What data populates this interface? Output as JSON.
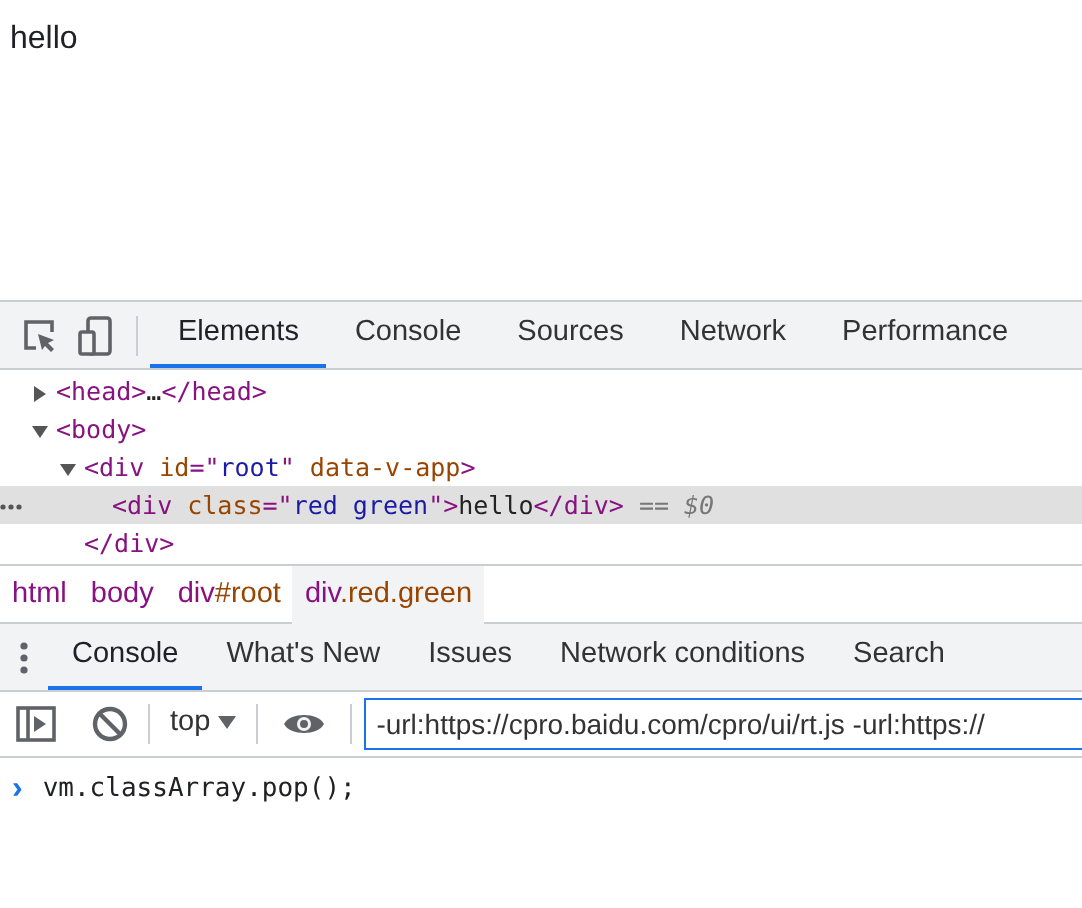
{
  "page": {
    "text": "hello"
  },
  "devtools_tabs": [
    {
      "label": "Elements",
      "selected": true
    },
    {
      "label": "Console",
      "selected": false
    },
    {
      "label": "Sources",
      "selected": false
    },
    {
      "label": "Network",
      "selected": false
    },
    {
      "label": "Performance",
      "selected": false
    }
  ],
  "dom_tree": [
    {
      "expanded": false,
      "selected": false,
      "segments": [
        {
          "kind": "tag",
          "text": "<head>"
        },
        {
          "kind": "text",
          "text": "…"
        },
        {
          "kind": "tag",
          "text": "</head>"
        }
      ]
    },
    {
      "expanded": true,
      "selected": false,
      "segments": [
        {
          "kind": "tag",
          "text": "<body>"
        }
      ],
      "children": [
        {
          "expanded": true,
          "selected": false,
          "segments": [
            {
              "kind": "tag",
              "text": "<div"
            },
            {
              "kind": "attr",
              "text": " id"
            },
            {
              "kind": "tag",
              "text": "=\""
            },
            {
              "kind": "value",
              "text": "root"
            },
            {
              "kind": "tag",
              "text": "\""
            },
            {
              "kind": "attr",
              "text": " data-v-app"
            },
            {
              "kind": "tag",
              "text": ">"
            }
          ],
          "children": [
            {
              "selected": true,
              "segments": [
                {
                  "kind": "tag",
                  "text": "<div"
                },
                {
                  "kind": "attr",
                  "text": " class"
                },
                {
                  "kind": "tag",
                  "text": "=\""
                },
                {
                  "kind": "value",
                  "text": "red green"
                },
                {
                  "kind": "tag",
                  "text": "\">"
                },
                {
                  "kind": "text",
                  "text": "hello"
                },
                {
                  "kind": "tag",
                  "text": "</div>"
                },
                {
                  "kind": "muted",
                  "text": " == "
                },
                {
                  "kind": "ref",
                  "text": "$0"
                }
              ]
            }
          ],
          "close": [
            {
              "kind": "tag",
              "text": "</div>"
            }
          ]
        }
      ]
    }
  ],
  "breadcrumbs": [
    {
      "selected": false,
      "segments": [
        {
          "kind": "tag",
          "text": "html"
        }
      ]
    },
    {
      "selected": false,
      "segments": [
        {
          "kind": "tag",
          "text": "body"
        }
      ]
    },
    {
      "selected": false,
      "segments": [
        {
          "kind": "tag",
          "text": "div"
        },
        {
          "kind": "attr",
          "text": "#root"
        }
      ]
    },
    {
      "selected": true,
      "segments": [
        {
          "kind": "tag",
          "text": "div"
        },
        {
          "kind": "attr",
          "text": ".red.green"
        }
      ]
    }
  ],
  "drawer_tabs": [
    {
      "label": "Console",
      "selected": true
    },
    {
      "label": "What's New",
      "selected": false
    },
    {
      "label": "Issues",
      "selected": false
    },
    {
      "label": "Network conditions",
      "selected": false
    },
    {
      "label": "Search",
      "selected": false
    }
  ],
  "console_toolbar": {
    "context": "top",
    "filter": "-url:https://cpro.baidu.com/cpro/ui/rt.js -url:https://"
  },
  "console_lines": [
    {
      "prompt": "›",
      "text": "vm.classArray.pop();"
    }
  ]
}
